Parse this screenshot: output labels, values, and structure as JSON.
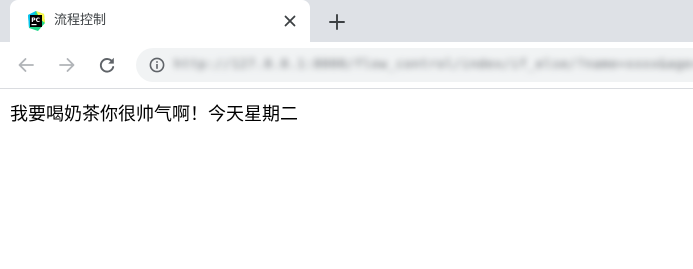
{
  "tab": {
    "title": "流程控制",
    "favicon": "pycharm-icon",
    "close_icon": "close-icon"
  },
  "tab_strip": {
    "new_tab_icon": "plus-icon"
  },
  "toolbar": {
    "back_icon": "arrow-left-icon",
    "forward_icon": "arrow-right-icon",
    "reload_icon": "reload-icon",
    "site_info_icon": "info-icon",
    "url_text": "http://127.0.0.1:8000/flow_control/index/if_else/?name=xxxx&age=18"
  },
  "page": {
    "content_text": "我要喝奶茶你很帅气啊！今天星期二"
  },
  "colors": {
    "tab_strip_bg": "#dee1e6",
    "omnibox_bg": "#f1f3f4",
    "icon_gray": "#5f6368",
    "disabled_gray": "#b1b4b8"
  }
}
